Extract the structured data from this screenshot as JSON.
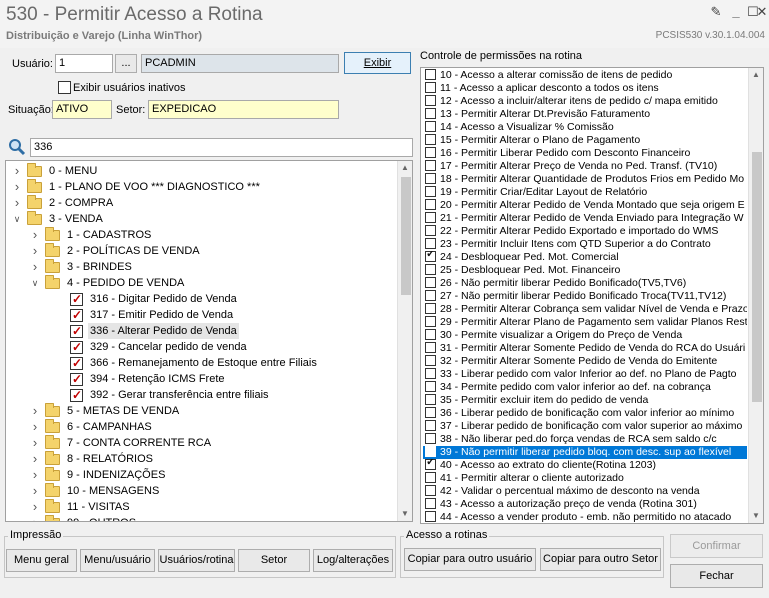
{
  "window": {
    "title": "530 - Permitir Acesso a Rotina",
    "subtitle": "Distribuição e Varejo (Linha WinThor)",
    "version": "PCSIS530  v.30.1.04.004"
  },
  "user": {
    "label": "Usuário:",
    "code": "1",
    "browse_label": "...",
    "name": "PCADMIN",
    "show_button": "Exibir",
    "show_inactive_label": "Exibir usuários inativos",
    "situation_label": "Situação:",
    "situation": "ATIVO",
    "sector_label": "Setor:",
    "sector": "EXPEDICAO"
  },
  "search": {
    "value": "336"
  },
  "tree": [
    {
      "label": "0 - MENU",
      "level": 0,
      "type": "folder",
      "expanded": false
    },
    {
      "label": "1 - PLANO DE VOO   *** DIAGNOSTICO ***",
      "level": 0,
      "type": "folder",
      "expanded": false
    },
    {
      "label": "2 - COMPRA",
      "level": 0,
      "type": "folder",
      "expanded": false
    },
    {
      "label": "3 - VENDA",
      "level": 0,
      "type": "folder",
      "expanded": true
    },
    {
      "label": "1 - CADASTROS",
      "level": 1,
      "type": "folder",
      "expanded": false
    },
    {
      "label": "2 - POLÍTICAS DE VENDA",
      "level": 1,
      "type": "folder",
      "expanded": false
    },
    {
      "label": "3 - BRINDES",
      "level": 1,
      "type": "folder",
      "expanded": false
    },
    {
      "label": "4 - PEDIDO DE VENDA",
      "level": 1,
      "type": "folder",
      "expanded": true
    },
    {
      "label": "316 - Digitar Pedido de Venda",
      "level": 2,
      "type": "check",
      "checked": true
    },
    {
      "label": "317 - Emitir Pedido de Venda",
      "level": 2,
      "type": "check",
      "checked": true
    },
    {
      "label": "336 - Alterar Pedido de Venda",
      "level": 2,
      "type": "check",
      "checked": true,
      "selected": true
    },
    {
      "label": "329 - Cancelar pedido de venda",
      "level": 2,
      "type": "check",
      "checked": true
    },
    {
      "label": "366 - Remanejamento de Estoque entre Filiais",
      "level": 2,
      "type": "check",
      "checked": true
    },
    {
      "label": "394 - Retenção ICMS Frete",
      "level": 2,
      "type": "check",
      "checked": true
    },
    {
      "label": "392 - Gerar transferência entre filiais",
      "level": 2,
      "type": "check",
      "checked": true
    },
    {
      "label": "5 - METAS DE VENDA",
      "level": 1,
      "type": "folder",
      "expanded": false
    },
    {
      "label": "6 - CAMPANHAS",
      "level": 1,
      "type": "folder",
      "expanded": false
    },
    {
      "label": "7 - CONTA CORRENTE RCA",
      "level": 1,
      "type": "folder",
      "expanded": false
    },
    {
      "label": "8 - RELATÓRIOS",
      "level": 1,
      "type": "folder",
      "expanded": false
    },
    {
      "label": "9 - INDENIZAÇÕES",
      "level": 1,
      "type": "folder",
      "expanded": false
    },
    {
      "label": "10 - MENSAGENS",
      "level": 1,
      "type": "folder",
      "expanded": false
    },
    {
      "label": "11 - VISITAS",
      "level": 1,
      "type": "folder",
      "expanded": false
    },
    {
      "label": "99 - OUTROS",
      "level": 1,
      "type": "folder",
      "expanded": false
    }
  ],
  "permissions_title": "Controle de permissões na rotina",
  "permissions": [
    {
      "text": "10 - Acesso a alterar comissão de itens de pedido",
      "checked": false
    },
    {
      "text": "11 - Acesso a aplicar desconto a todos os itens",
      "checked": false
    },
    {
      "text": "12 - Acesso a incluir/alterar itens de pedido c/ mapa emitido",
      "checked": false
    },
    {
      "text": "13 - Permitir Alterar Dt.Previsão Faturamento",
      "checked": false
    },
    {
      "text": "14 - Acesso a Visualizar % Comissão",
      "checked": false
    },
    {
      "text": "15 - Permitir Alterar o Plano de Pagamento",
      "checked": false
    },
    {
      "text": "16 - Permitir Liberar Pedido com Desconto Financeiro",
      "checked": false
    },
    {
      "text": "17 - Permitir Alterar Preço de Venda no Ped. Transf. (TV10)",
      "checked": false
    },
    {
      "text": "18 - Permitir Alterar Quantidade de Produtos Frios em Pedido Mo",
      "checked": false
    },
    {
      "text": "19 - Permitir Criar/Editar Layout de Relatório",
      "checked": false
    },
    {
      "text": "20 - Permitir Alterar Pedido de Venda Montado que seja origem E",
      "checked": false
    },
    {
      "text": "21 - Permitir Alterar Pedido de Venda Enviado para Integração W",
      "checked": false
    },
    {
      "text": "22 - Permitir Alterar Pedido Exportado e importado do WMS",
      "checked": false
    },
    {
      "text": "23 - Permitir Incluir Itens com QTD Superior a do Contrato",
      "checked": false
    },
    {
      "text": "24 - Desbloquear Ped. Mot. Comercial",
      "checked": true
    },
    {
      "text": "25 - Desbloquear Ped. Mot. Financeiro",
      "checked": false
    },
    {
      "text": "26 - Não permitir liberar Pedido Bonificado(TV5,TV6)",
      "checked": false
    },
    {
      "text": "27 - Não permitir liberar Pedido Bonificado Troca(TV11,TV12)",
      "checked": false
    },
    {
      "text": "28 - Permitir Alterar Cobrança sem validar Nível de Venda e Prazo",
      "checked": false
    },
    {
      "text": "29 - Permitir Alterar Plano de Pagamento sem validar Planos Rest",
      "checked": false
    },
    {
      "text": "30 - Permite visualizar a Origem do Preço de Venda",
      "checked": false
    },
    {
      "text": "31 - Permitir Alterar Somente Pedido de Venda do RCA do Usuári",
      "checked": false
    },
    {
      "text": "32 - Permitir Alterar Somente Pedido de Venda do Emitente",
      "checked": false
    },
    {
      "text": "33 - Liberar pedido com valor Inferior ao def. no Plano de Pagto",
      "checked": false
    },
    {
      "text": "34 - Permite pedido com valor inferior ao def. na cobrança",
      "checked": false
    },
    {
      "text": "35 - Permitir excluir item do pedido de venda",
      "checked": false
    },
    {
      "text": "36 - Liberar pedido de bonificação com valor inferior ao mínimo",
      "checked": false
    },
    {
      "text": "37 - Liberar pedido de bonificação com valor superior ao máximo",
      "checked": false
    },
    {
      "text": "38 - Não liberar ped.do força vendas de RCA sem saldo c/c",
      "checked": false
    },
    {
      "text": "39 - Não permitir liberar pedido bloq. com desc. sup ao flexível",
      "checked": false,
      "highlighted": true
    },
    {
      "text": "40 - Acesso ao extrato do cliente(Rotina 1203)",
      "checked": true
    },
    {
      "text": "41 - Permitir alterar o cliente autorizado",
      "checked": false
    },
    {
      "text": "42 - Validar o percentual máximo de desconto na venda",
      "checked": false
    },
    {
      "text": "43 - Acesso a autorização preço de venda (Rotina 301)",
      "checked": false
    },
    {
      "text": "44 - Acesso a vender produto - emb. não permitido no atacado",
      "checked": false
    }
  ],
  "print_group": {
    "title": "Impressão",
    "buttons": [
      "Menu geral",
      "Menu/usuário",
      "Usuários/rotina",
      "Setor",
      "Log/alterações"
    ]
  },
  "routine_group": {
    "title": "Acesso a rotinas",
    "buttons": [
      "Copiar para outro usuário",
      "Copiar para outro Setor"
    ]
  },
  "actions": {
    "confirm": "Confirmar",
    "close": "Fechar"
  }
}
